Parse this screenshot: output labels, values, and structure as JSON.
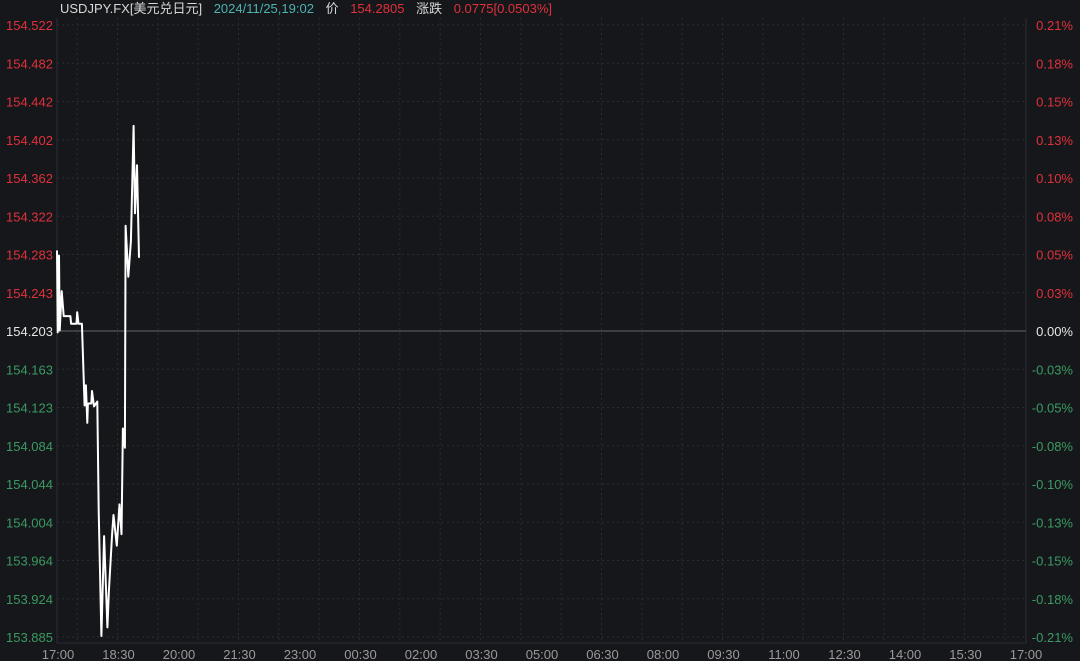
{
  "header": {
    "symbol": "USDJPY.FX[美元兑日元]",
    "datetime": "2024/11/25,19:02",
    "price_label": "价",
    "price": "154.2805",
    "change_label": "涨跌",
    "change": "0.0775[0.0503%]"
  },
  "colors": {
    "background": "#16171b",
    "up": "#e0313b",
    "down": "#3a9a62",
    "neutral": "#e6e6e6",
    "datetime": "#4db3b3",
    "line": "#ffffff"
  },
  "chart_data": {
    "type": "line",
    "title": "",
    "xlabel": "",
    "ylabel": "",
    "ylim": [
      153.885,
      154.522
    ],
    "reference_price": 154.203,
    "grid": true,
    "x_ticks": [
      "17:00",
      "18:30",
      "20:00",
      "21:30",
      "23:00",
      "00:30",
      "02:00",
      "03:30",
      "05:00",
      "06:30",
      "08:00",
      "09:30",
      "11:00",
      "12:30",
      "14:00",
      "15:30",
      "17:00"
    ],
    "y_ticks_left": [
      "154.522",
      "154.482",
      "154.442",
      "154.402",
      "154.362",
      "154.322",
      "154.283",
      "154.243",
      "154.203",
      "154.163",
      "154.123",
      "154.084",
      "154.044",
      "154.004",
      "153.964",
      "153.924",
      "153.885"
    ],
    "y_ticks_right": [
      "0.21%",
      "0.18%",
      "0.15%",
      "0.13%",
      "0.10%",
      "0.08%",
      "0.05%",
      "0.03%",
      "0.00%",
      "-0.03%",
      "-0.05%",
      "-0.08%",
      "-0.10%",
      "-0.13%",
      "-0.15%",
      "-0.18%",
      "-0.21%"
    ],
    "series": [
      {
        "x": [
          "17:00",
          "17:01",
          "17:03",
          "17:04",
          "17:07",
          "17:10",
          "17:20",
          "17:21",
          "17:29",
          "17:30",
          "17:32",
          "17:37",
          "17:41",
          "17:43",
          "17:45",
          "17:46",
          "17:51",
          "17:52",
          "17:55",
          "18:00",
          "18:02",
          "18:06",
          "18:10",
          "18:15",
          "18:17",
          "18:22",
          "18:24",
          "18:29",
          "18:33",
          "18:36",
          "18:38",
          "18:41",
          "18:42",
          "18:46",
          "18:50",
          "18:54",
          "18:56",
          "18:59",
          "19:02"
        ],
        "y": [
          154.287,
          154.202,
          154.282,
          154.204,
          154.245,
          154.219,
          154.219,
          154.211,
          154.211,
          154.223,
          154.211,
          154.211,
          154.126,
          154.147,
          154.108,
          154.128,
          154.128,
          154.141,
          154.125,
          154.13,
          154.016,
          153.886,
          153.99,
          153.895,
          153.931,
          153.992,
          154.012,
          153.98,
          154.023,
          153.992,
          154.102,
          154.082,
          154.313,
          154.26,
          154.297,
          154.417,
          154.326,
          154.376,
          154.28
        ]
      }
    ]
  }
}
